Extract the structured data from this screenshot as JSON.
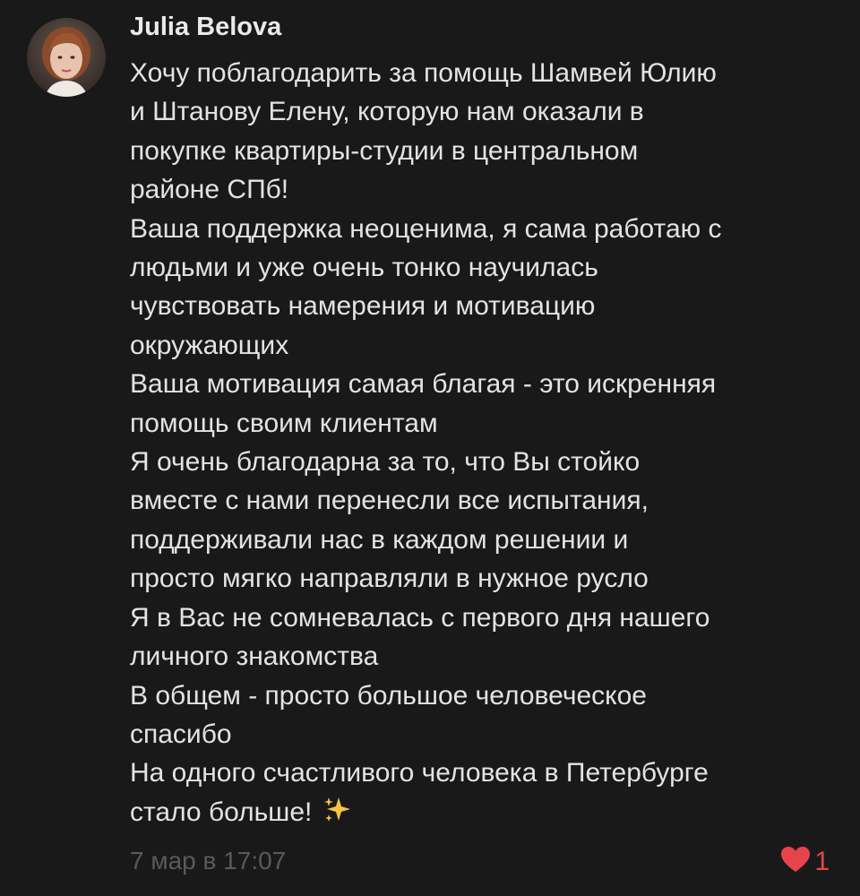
{
  "comment": {
    "author": "Julia Belova",
    "lines": [
      "Хочу поблагодарить за помощь Шамвей Юлию",
      "и Штанову Елену, которую нам оказали в",
      "покупке квартиры-студии в центральном",
      "районе СПб!",
      "Ваша поддержка неоценима, я сама работаю с",
      "людьми и уже очень тонко научилась",
      "чувствовать намерения и мотивацию",
      "окружающих",
      "Ваша мотивация самая благая - это искренняя",
      "помощь своим клиентам",
      "Я очень благодарна за то, что Вы стойко",
      "вместе с нами перенесли все испытания,",
      "поддерживали нас в каждом решении и",
      "просто мягко направляли в нужное русло",
      "Я в Вас не сомневалась с первого дня нашего",
      "личного знакомства",
      "В общем - просто большое человеческое",
      "спасибо",
      "На одного счастливого человека в Петербурге",
      "стало больше!"
    ],
    "timestamp": "7 мар в 17:07",
    "likes": "1"
  },
  "icons": {
    "avatar": "user-photo",
    "sparkles": "sparkles-emoji",
    "like": "heart-icon"
  },
  "colors": {
    "background": "#19191a",
    "text": "#e3e3e3",
    "meta": "#5a5a5c",
    "like": "#e8434d"
  }
}
